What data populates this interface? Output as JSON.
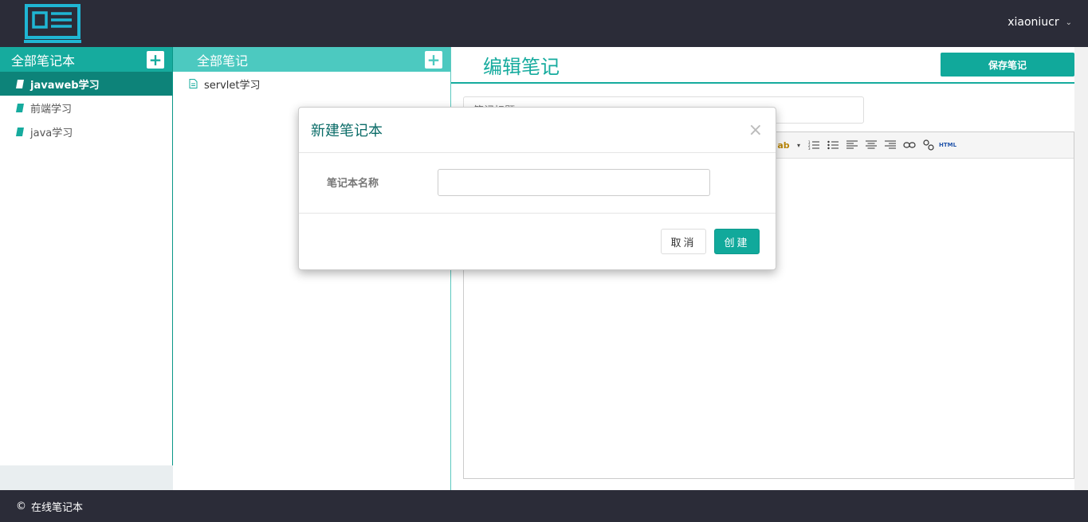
{
  "header": {
    "username": "xiaoniucr"
  },
  "notebooks": {
    "title": "全部笔记本",
    "add_label": "+",
    "items": [
      {
        "label": "javaweb学习",
        "active": true
      },
      {
        "label": "前端学习",
        "active": false
      },
      {
        "label": "java学习",
        "active": false
      }
    ]
  },
  "notes": {
    "title": "全部笔记",
    "add_label": "+",
    "items": [
      {
        "label": "servlet学习"
      }
    ]
  },
  "editor": {
    "title": "编辑笔记",
    "save_label": "保存笔记",
    "title_placeholder": "笔记标题",
    "toolbar_html_label": "HTML"
  },
  "footer": {
    "copyright_symbol": "©",
    "text": "在线笔记本"
  },
  "modal": {
    "title": "新建笔记本",
    "close_label": "×",
    "field_label": "笔记本名称",
    "field_value": "",
    "cancel_label": "取消",
    "create_label": "创建"
  },
  "colors": {
    "accent": "#16ab9e",
    "accent_dark": "#0d8379",
    "accent_light": "#4cc9c0",
    "topbar": "#2b2c38"
  }
}
